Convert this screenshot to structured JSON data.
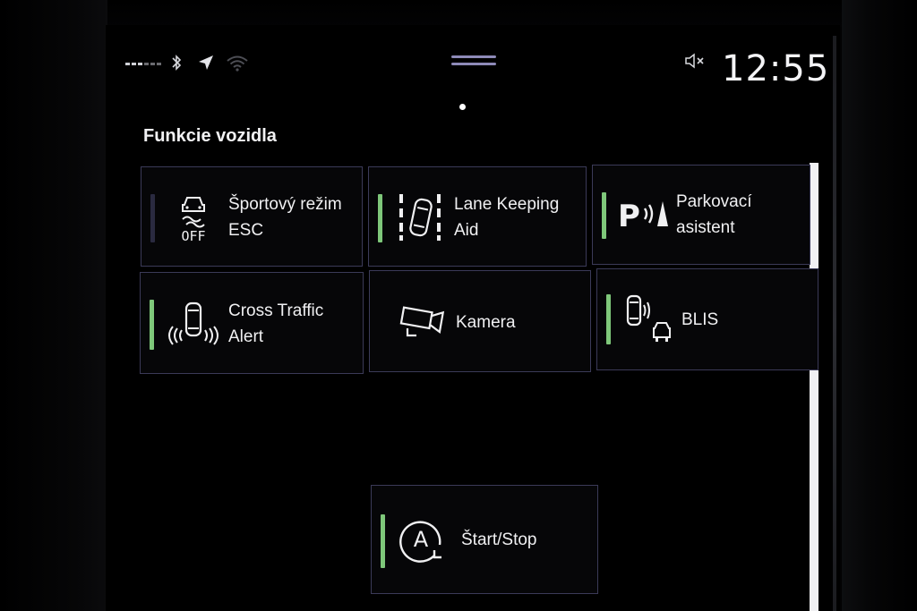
{
  "status_bar": {
    "clock": "12:55",
    "icons": [
      "signal-icon",
      "bluetooth-icon",
      "location-icon",
      "wifi-icon",
      "mute-icon"
    ]
  },
  "section": {
    "title": "Funkcie vozidla"
  },
  "tiles": [
    {
      "label": "Športový režim\nESC",
      "icon": "esc-off-icon",
      "active": false,
      "badge": "OFF"
    },
    {
      "label": "Lane Keeping\nAid",
      "icon": "lane-keeping-icon",
      "active": true
    },
    {
      "label": "Parkovací\nasistent",
      "icon": "park-assist-icon",
      "active": true,
      "badge": "P"
    },
    {
      "label": "Cross Traffic\nAlert",
      "icon": "cross-traffic-icon",
      "active": true
    },
    {
      "label": "Kamera",
      "icon": "camera-icon",
      "active": false
    },
    {
      "label": "BLIS",
      "icon": "blis-icon",
      "active": true
    },
    {
      "label": "Štart/Stop",
      "icon": "start-stop-icon",
      "active": true,
      "badge": "A"
    }
  ],
  "colors": {
    "active_indicator": "#7ec77a",
    "inactive_indicator": "#2a2a40",
    "tile_border": "#3b3a58",
    "background": "#000000"
  }
}
